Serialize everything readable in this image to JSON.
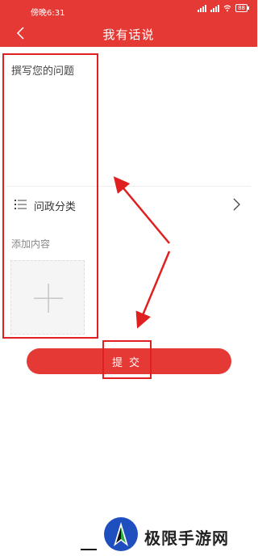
{
  "status_bar": {
    "time": "傍晚6:31",
    "battery": "88"
  },
  "header": {
    "title": "我有话说"
  },
  "form": {
    "question_placeholder": "撰写您的问题",
    "category_label": "问政分类",
    "add_content_label": "添加内容"
  },
  "submit": {
    "label": "提交"
  },
  "watermark": {
    "text": "极限手游网"
  },
  "colors": {
    "brand_red": "#e53935",
    "annotation_red": "#e02020"
  }
}
